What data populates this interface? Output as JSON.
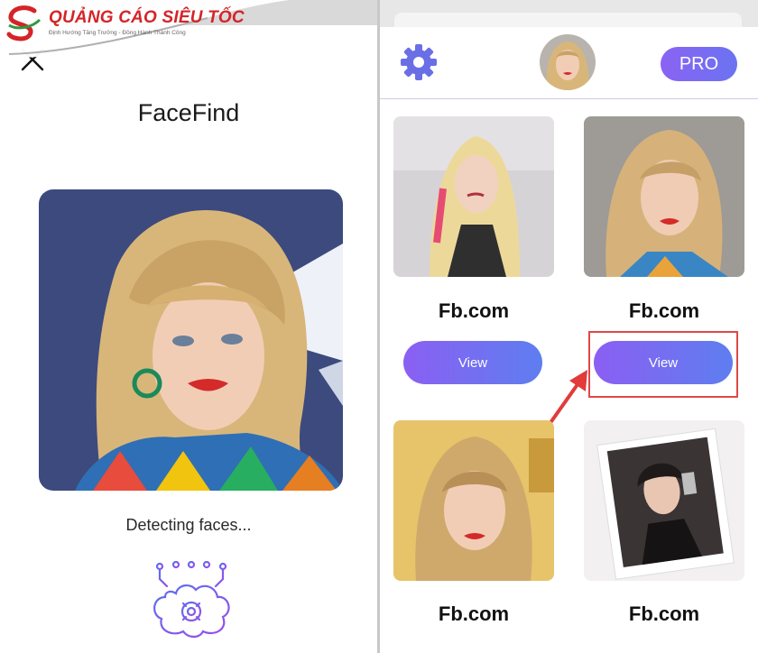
{
  "watermark": {
    "brand": "QUẢNG CÁO SIÊU TỐC",
    "slogan": "Định Hướng Tăng Trưởng - Đồng Hành Thành Công"
  },
  "left": {
    "close_icon": "close-icon",
    "app_title": "FaceFind",
    "status": "Detecting faces...",
    "scan_icon": "brain-circuit-icon"
  },
  "right": {
    "settings_icon": "gear-icon",
    "pro_label": "PRO",
    "results": [
      {
        "source": "Fb.com",
        "button": "View"
      },
      {
        "source": "Fb.com",
        "button": "View"
      },
      {
        "source": "Fb.com"
      },
      {
        "source": "Fb.com"
      }
    ]
  },
  "colors": {
    "accent": "#7b6cf2",
    "highlight": "#e04848",
    "gear": "#6a6fe6"
  }
}
